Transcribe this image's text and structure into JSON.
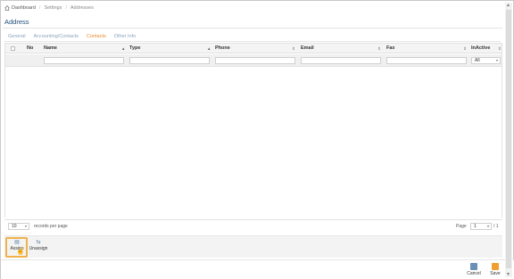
{
  "breadcrumb": {
    "home_icon": "home-icon",
    "items": [
      "Dashboard",
      "Settings",
      "Addresses"
    ]
  },
  "page": {
    "title": "Address"
  },
  "tabs": [
    {
      "label": "General",
      "active": false
    },
    {
      "label": "Accounting/Contacts",
      "active": false
    },
    {
      "label": "Contacts",
      "active": true
    },
    {
      "label": "Other Info",
      "active": false
    }
  ],
  "grid": {
    "columns": [
      {
        "label": "No",
        "sort": ""
      },
      {
        "label": "Name",
        "sort": "▲"
      },
      {
        "label": "Type",
        "sort": "▲"
      },
      {
        "label": "Phone",
        "sort": "⇕"
      },
      {
        "label": "Email",
        "sort": "⇕"
      },
      {
        "label": "Fax",
        "sort": "⇕"
      },
      {
        "label": "InActive",
        "sort": "⇕"
      }
    ],
    "filter_inactive": "All",
    "rows": []
  },
  "pager": {
    "page_size": "10",
    "records_per_page": "records per page",
    "page_label": "Page",
    "page_number": "1",
    "page_total": "/ 1"
  },
  "actions": {
    "assign": "Assign",
    "unassign": "Unassign"
  },
  "footer": {
    "cancel": "Cancel",
    "save": "Save"
  },
  "colors": {
    "title": "#1f4e79",
    "active_tab": "#e8882e",
    "highlight": "#f0b24a",
    "cancel_icon": "#6b8fb5",
    "save_icon": "#f0a030"
  }
}
